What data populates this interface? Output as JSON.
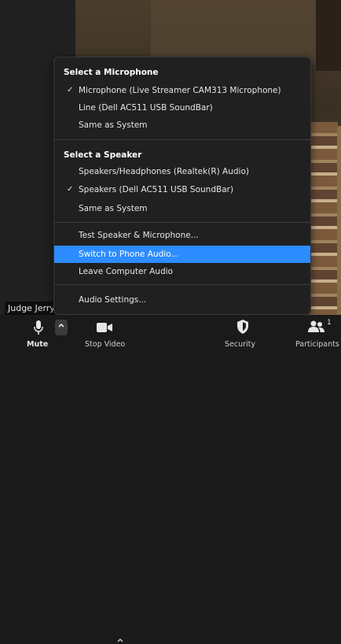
{
  "menu": {
    "microphone_header": "Select a Microphone",
    "microphones": [
      {
        "label": "Microphone (Live Streamer CAM313 Microphone)",
        "checked": true
      },
      {
        "label": "Line (Dell AC511 USB SoundBar)",
        "checked": false
      },
      {
        "label": "Same as System",
        "checked": false
      }
    ],
    "speaker_header": "Select a Speaker",
    "speakers": [
      {
        "label": "Speakers/Headphones (Realtek(R) Audio)",
        "checked": false
      },
      {
        "label": "Speakers (Dell AC511 USB SoundBar)",
        "checked": true
      },
      {
        "label": "Same as System",
        "checked": false
      }
    ],
    "check_glyph": "✓",
    "test": "Test Speaker & Microphone...",
    "switch_phone": "Switch to Phone Audio...",
    "leave": "Leave Computer Audio",
    "settings": "Audio Settings..."
  },
  "video": {
    "participant_name": "Judge Jerry"
  },
  "toolbar": {
    "mute": "Mute",
    "stop_video": "Stop Video",
    "security": "Security",
    "participants": "Participants",
    "participant_count": "1"
  },
  "colors": {
    "highlight": "#2d8cff",
    "menu_bg": "#202020",
    "toolbar_bg": "#1a1a1a"
  }
}
